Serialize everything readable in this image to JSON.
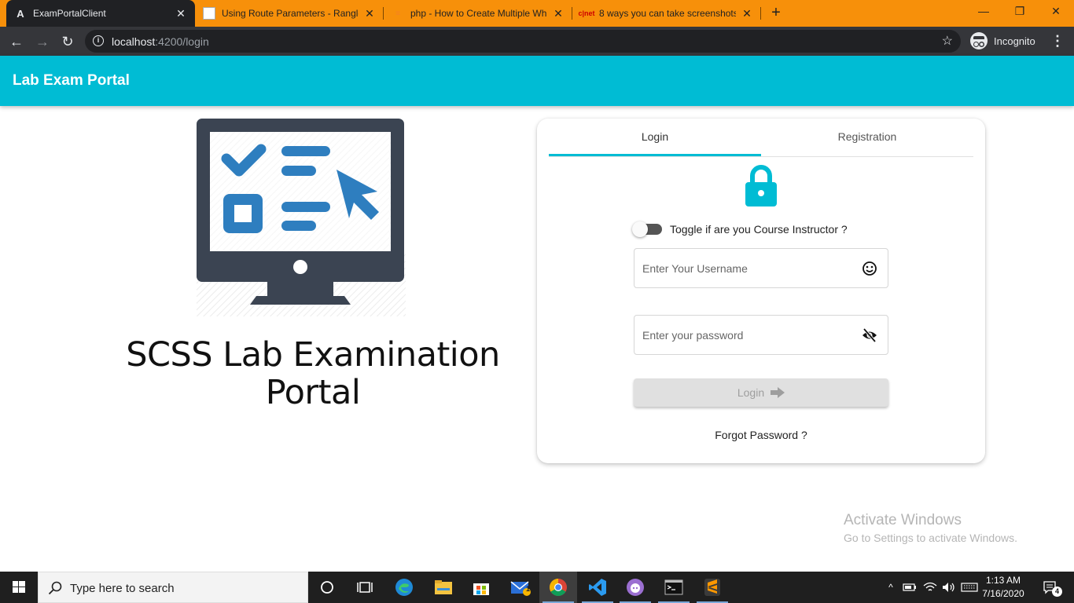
{
  "browser": {
    "tabs": [
      {
        "title": "ExamPortalClient",
        "active": true
      },
      {
        "title": "Using Route Parameters - Rangle.io",
        "active": false
      },
      {
        "title": "php - How to Create Multiple Wh",
        "active": false
      },
      {
        "title": "8 ways you can take screenshots",
        "active": false
      }
    ],
    "url_host": "localhost",
    "url_rest": ":4200/login",
    "profile_label": "Incognito"
  },
  "app": {
    "brand": "Lab Exam Portal",
    "hero_title": "SCSS Lab Examination Portal",
    "accent_color": "#00bcd4"
  },
  "login_card": {
    "tabs": [
      "Login",
      "Registration"
    ],
    "active_tab": "Login",
    "toggle_label": "Toggle if are you Course Instructor ?",
    "toggle_on": false,
    "username": {
      "placeholder": "Enter Your Username",
      "value": ""
    },
    "password": {
      "placeholder": "Enter your password",
      "value": ""
    },
    "login_button": "Login",
    "login_enabled": false,
    "forgot_link": "Forgot Password ?"
  },
  "watermark": {
    "line1": "Activate Windows",
    "line2": "Go to Settings to activate Windows."
  },
  "taskbar": {
    "search_placeholder": "Type here to search",
    "mail_badge": "1",
    "time": "1:13 AM",
    "date": "7/16/2020",
    "notification_count": "4"
  }
}
